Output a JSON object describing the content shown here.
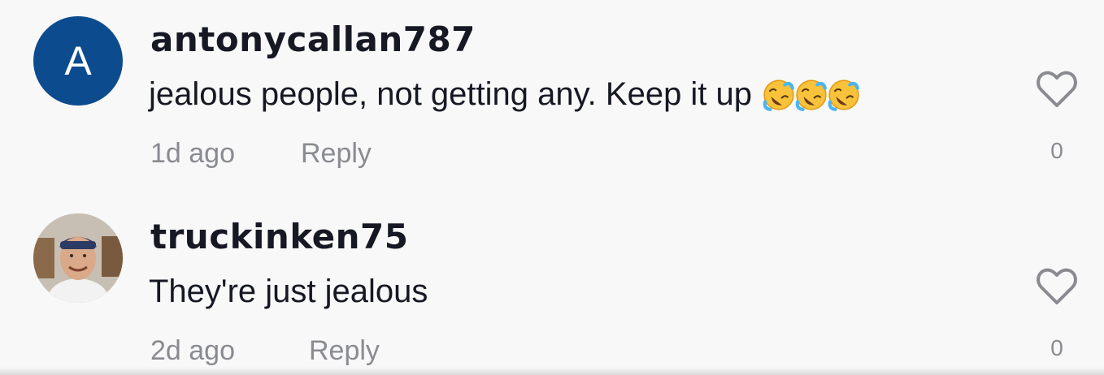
{
  "comments": [
    {
      "avatar_letter": "A",
      "avatar_color": "#0c4b8e",
      "username": "antonycallan787",
      "text": "jealous people, not getting any. Keep it up",
      "emojis": [
        "rolling-on-floor-laughing",
        "rolling-on-floor-laughing",
        "rolling-on-floor-laughing"
      ],
      "time": "1d ago",
      "reply_label": "Reply",
      "likes": "0"
    },
    {
      "avatar_letter": "",
      "username": "truckinken75",
      "text": "They're just jealous",
      "emojis": [],
      "time": "2d ago",
      "reply_label": "Reply",
      "likes": "0"
    }
  ],
  "colors": {
    "background": "#f8f8f8",
    "text": "#161823",
    "muted": "#8a8b91"
  }
}
